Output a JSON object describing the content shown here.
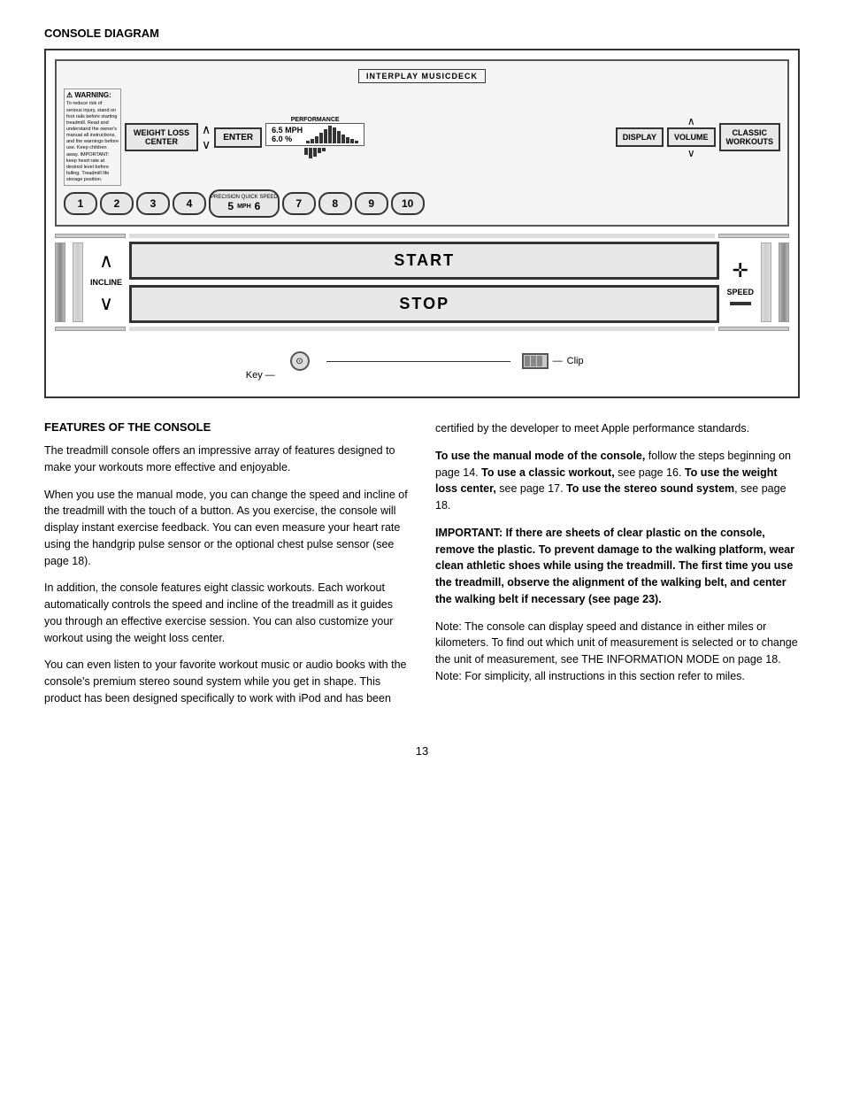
{
  "page": {
    "diagram_title": "CONSOLE DIAGRAM",
    "features_title": "FEATURES OF THE CONSOLE",
    "page_number": "13"
  },
  "console": {
    "interplay_label": "INTERPLAY MUSICDECK",
    "weight_loss_center": "WEIGHT LOSS\nCENTER",
    "enter_label": "ENTER",
    "performance_label": "PERFORMANCE",
    "speed_display": "6.5 MPH",
    "grade_display": "6.0 %",
    "precision_quick_speed": "PRECISION QUICK SPEED",
    "mph_label": "MPH",
    "display_label": "DISPLAY",
    "volume_label": "VOLUME",
    "classic_workouts_label": "CLASSIC\nWORKOUTS",
    "start_label": "START",
    "stop_label": "STOP",
    "incline_label": "INCLINE",
    "speed_label": "SPEED",
    "key_label": "Key",
    "clip_label": "Clip",
    "warning_label": "WARNING:",
    "warning_text": "To reduce risk of serious injury, stand on foot rails before starting treadmill. Read and understand the owner's manual all instructions, and the warnings before use. Keep children away. IMPORTANT: keep heart rate at desired level before falling. Treadmill life storage position.",
    "number_keys": [
      "1",
      "2",
      "3",
      "4",
      "5",
      "6",
      "7",
      "8",
      "9",
      "10"
    ],
    "bars": [
      3,
      5,
      8,
      12,
      16,
      20,
      18,
      14,
      10,
      7,
      5,
      3
    ]
  },
  "features": {
    "left": {
      "para1": "The treadmill console offers an impressive array of features designed to make your workouts more effective and enjoyable.",
      "para2": "When you use the manual mode, you can change the speed and incline of the treadmill with the touch of a button. As you exercise, the console will display instant exercise feedback. You can even measure your heart rate using the handgrip pulse sensor or the optional chest pulse sensor (see page 18).",
      "para3": "In addition, the console features eight classic workouts. Each workout automatically controls the speed and incline of the treadmill as it guides you through an effective exercise session. You can also customize your workout using the weight loss center.",
      "para4": "You can even listen to your favorite workout music or audio books with the console's premium stereo sound system while you get in shape. This product has been designed specifically to work with iPod and has been"
    },
    "right": {
      "para1": "certified by the developer to meet Apple performance standards.",
      "para2_bold_1": "To use the manual mode of the console,",
      "para2_1": " follow the steps beginning on page 14.",
      "para2_bold_2": "To use a classic workout,",
      "para2_2": " see page 16.",
      "para2_bold_3": "To use the weight loss center,",
      "para2_3": " see page 17.",
      "para2_bold_4": "To use the stereo sound system",
      "para2_4": ", see page 18.",
      "para3_bold": "IMPORTANT: If there are sheets of clear plastic on the console, remove the plastic. To prevent damage to the walking platform, wear clean athletic shoes while using the treadmill. The first time you use the treadmill, observe the alignment of the walking belt, and center the walking belt if necessary (see page 23).",
      "para4": "Note: The console can display speed and distance in either miles or kilometers. To find out which unit of measurement is selected or to change the unit of measurement, see THE INFORMATION MODE on page 18. Note: For simplicity, all instructions in this section refer to miles."
    }
  }
}
